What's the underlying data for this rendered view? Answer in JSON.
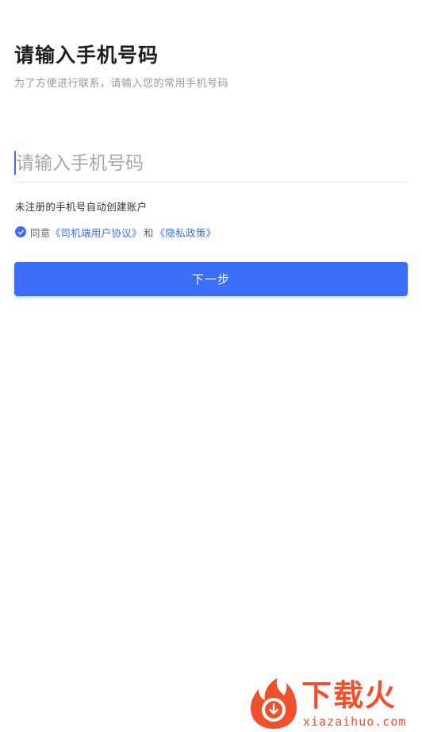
{
  "header": {
    "title": "请输入手机号码",
    "subtitle": "为了方便进行联系，请输入您的常用手机号码"
  },
  "phone_input": {
    "value": "",
    "placeholder": "请输入手机号码"
  },
  "hint": "未注册的手机号自动创建账户",
  "agreement": {
    "checked": true,
    "prefix": "同意",
    "user_agreement_link": "《司机端用户协议》",
    "and_text": "和",
    "privacy_link": "《隐私政策》"
  },
  "next_button_label": "下一步",
  "watermark": {
    "brand": "下载火",
    "domain": "xiazaihuo.com"
  },
  "colors": {
    "accent": "#3d6cf6",
    "watermark": "#f1502b"
  },
  "icons": {
    "agreement_checkbox": "check-circle-icon",
    "watermark_logo": "flame-download-icon"
  }
}
